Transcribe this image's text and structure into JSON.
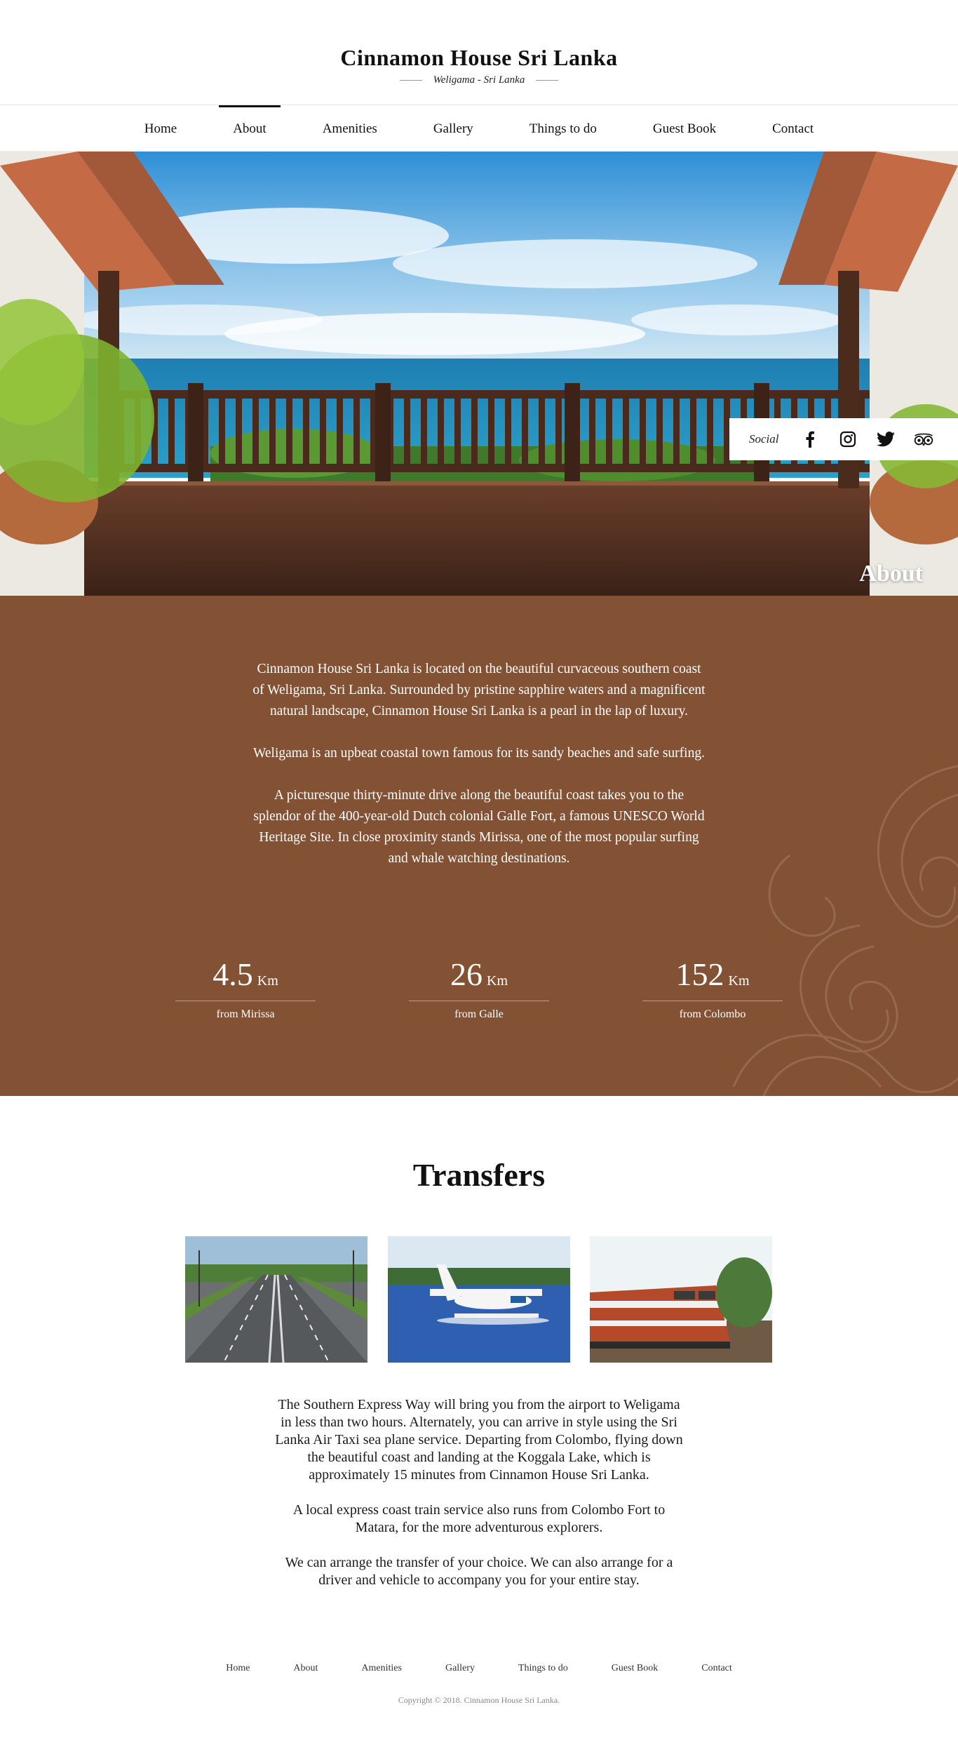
{
  "header": {
    "title": "Cinnamon House Sri Lanka",
    "subtitle": "Weligama - Sri Lanka"
  },
  "nav": {
    "items": [
      {
        "label": "Home"
      },
      {
        "label": "About",
        "active": true
      },
      {
        "label": "Amenities"
      },
      {
        "label": "Gallery"
      },
      {
        "label": "Things to do"
      },
      {
        "label": "Guest Book"
      },
      {
        "label": "Contact"
      }
    ]
  },
  "hero": {
    "title": "About",
    "social": {
      "label": "Social",
      "icons": [
        "facebook-icon",
        "instagram-icon",
        "twitter-icon",
        "tripadvisor-icon"
      ]
    }
  },
  "about": {
    "paragraphs": [
      "Cinnamon House Sri Lanka is located on the beautiful curvaceous southern coast of Weligama, Sri Lanka. Surrounded by pristine sapphire waters and a magnificent natural landscape, Cinnamon House Sri Lanka is a pearl in the lap of luxury.",
      "Weligama is an upbeat coastal town famous for its sandy beaches and safe surfing.",
      "A picturesque thirty-minute drive along the beautiful coast takes you to the splendor of the 400-year-old Dutch colonial Galle Fort, a famous UNESCO World Heritage Site. In close proximity stands Mirissa, one of the most popular surfing and whale watching destinations."
    ],
    "stats": [
      {
        "value": "4.5",
        "unit": "Km",
        "label": "from Mirissa"
      },
      {
        "value": "26",
        "unit": "Km",
        "label": "from Galle"
      },
      {
        "value": "152",
        "unit": "Km",
        "label": "from Colombo"
      }
    ],
    "background_color": "#835234"
  },
  "transfers": {
    "title": "Transfers",
    "images": [
      "expressway-photo",
      "seaplane-photo",
      "train-photo"
    ],
    "paragraphs": [
      "The Southern Express Way will bring you from the airport to Weligama in less than two hours. Alternately, you can arrive in style using the Sri Lanka Air Taxi sea plane service. Departing from Colombo, flying down the beautiful coast and landing at the Koggala Lake, which is approximately 15 minutes from Cinnamon House Sri Lanka.",
      "A local express coast train service also runs from Colombo Fort to Matara, for the more adventurous explorers.",
      "We can arrange the transfer of your choice. We can also arrange for a driver and vehicle to accompany you for your entire stay."
    ]
  },
  "footer": {
    "links": [
      "Home",
      "About",
      "Amenities",
      "Gallery",
      "Things to do",
      "Guest Book",
      "Contact"
    ],
    "copyright": "Copyright © 2018. Cinnamon House Sri Lanka."
  }
}
